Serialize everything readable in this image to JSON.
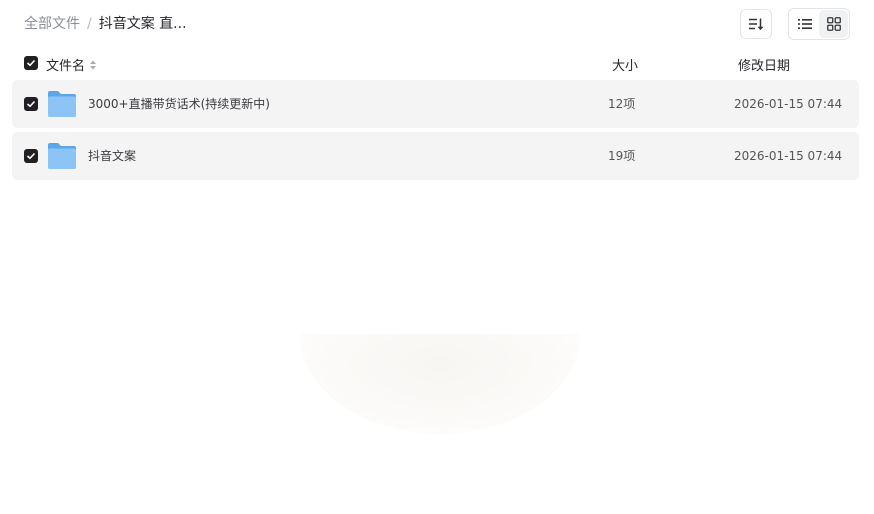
{
  "breadcrumb": {
    "root": "全部文件",
    "separator": "/",
    "current": "抖音文案 直..."
  },
  "toolbar": {
    "sort_icon": "sort-icon",
    "view_list_icon": "list-view-icon",
    "view_grid_icon": "grid-view-icon"
  },
  "table": {
    "headers": {
      "name": "文件名",
      "size": "大小",
      "date": "修改日期"
    },
    "rows": [
      {
        "name": "3000+直播带货话术(持续更新中)",
        "size": "12项",
        "date": "2026-01-15 07:44",
        "checked": true,
        "icon": "folder-icon"
      },
      {
        "name": "抖音文案",
        "size": "19项",
        "date": "2026-01-15 07:44",
        "checked": true,
        "icon": "folder-icon"
      }
    ]
  },
  "colors": {
    "row_bg": "#f4f4f5",
    "checkbox": "#1f2024",
    "folder": "#7db8f0"
  }
}
